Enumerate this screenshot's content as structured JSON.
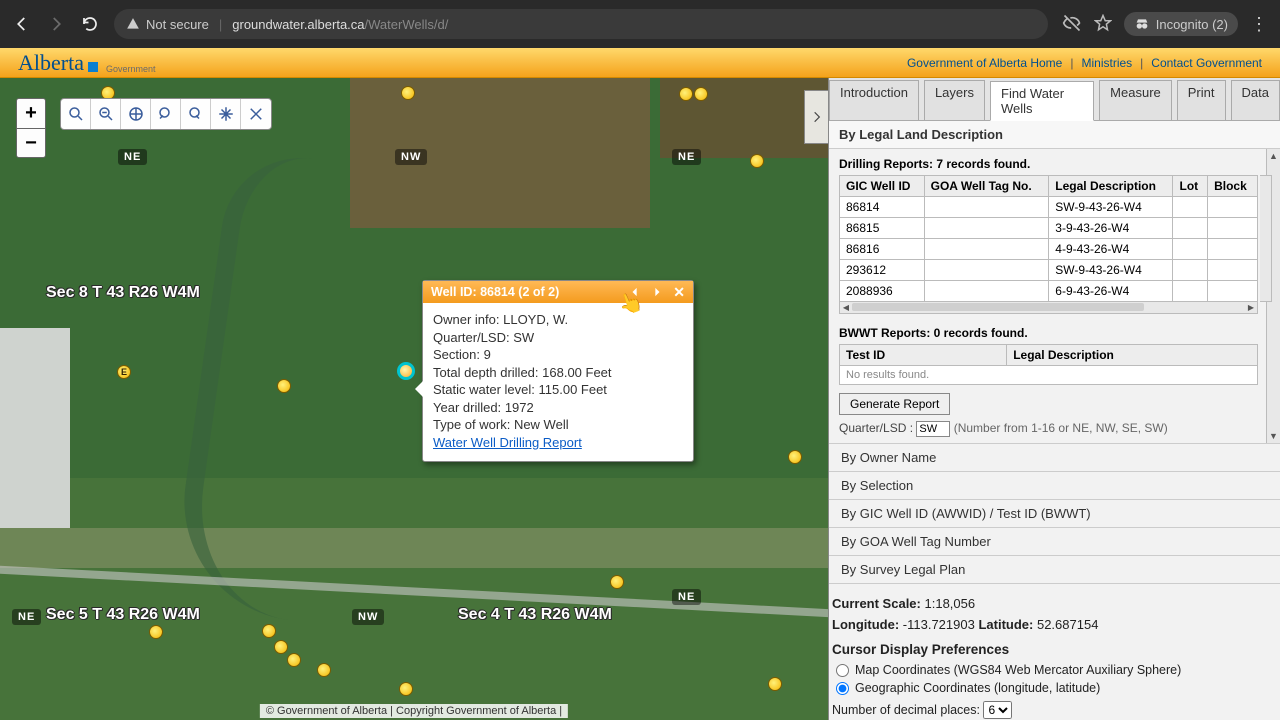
{
  "browser": {
    "not_secure": "Not secure",
    "url_host": "groundwater.alberta.ca",
    "url_path": "/WaterWells/d/",
    "incognito": "Incognito (2)"
  },
  "gov_links": {
    "home": "Government of Alberta Home",
    "ministries": "Ministries",
    "contact": "Contact Government"
  },
  "logo": {
    "word": "Alberta",
    "sub": "Government"
  },
  "tabs": {
    "intro": "Introduction",
    "layers": "Layers",
    "find": "Find Water Wells",
    "measure": "Measure",
    "print": "Print",
    "data": "Data"
  },
  "panel": {
    "section_title": "By Legal Land Description",
    "drill_msg": "Drilling Reports: 7 records found.",
    "cols": {
      "gic": "GIC Well ID",
      "goa": "GOA Well Tag No.",
      "legal": "Legal Description",
      "lot": "Lot",
      "block": "Block"
    },
    "rows": [
      {
        "gic": "86814",
        "goa": "",
        "legal": "SW-9-43-26-W4",
        "lot": "",
        "block": ""
      },
      {
        "gic": "86815",
        "goa": "",
        "legal": "3-9-43-26-W4",
        "lot": "",
        "block": ""
      },
      {
        "gic": "86816",
        "goa": "",
        "legal": "4-9-43-26-W4",
        "lot": "",
        "block": ""
      },
      {
        "gic": "293612",
        "goa": "",
        "legal": "SW-9-43-26-W4",
        "lot": "",
        "block": ""
      },
      {
        "gic": "2088936",
        "goa": "",
        "legal": "6-9-43-26-W4",
        "lot": "",
        "block": ""
      }
    ],
    "bwwt_msg": "BWWT Reports: 0 records found.",
    "bwwt_cols": {
      "test": "Test ID",
      "legal": "Legal Description"
    },
    "bwwt_empty": "No results found.",
    "gen_report": "Generate Report",
    "qlsd_label": "Quarter/LSD :",
    "qlsd_val": "SW",
    "qlsd_hint": "(Number from 1-16 or NE, NW, SE, SW)",
    "choices": {
      "owner": "By Owner Name",
      "selection": "By Selection",
      "gic": "By GIC Well ID (AWWID) / Test ID (BWWT)",
      "goa": "By GOA Well Tag Number",
      "survey": "By Survey Legal Plan"
    },
    "scale_label": "Current Scale:",
    "scale_val": "1:18,056",
    "lon_label": "Longitude:",
    "lon_val": "-113.721903",
    "lat_label": "Latitude:",
    "lat_val": "52.687154",
    "pref_header": "Cursor Display Preferences",
    "pref_map": "Map Coordinates (WGS84 Web Mercator Auxiliary Sphere)",
    "pref_geo": "Geographic Coordinates (longitude, latitude)",
    "dec_label": "Number of decimal places:",
    "dec_val": "6"
  },
  "popup": {
    "title": "Well ID: 86814 (2 of 2)",
    "owner_lbl": "Owner info:",
    "owner_val": "LLOYD, W.",
    "q_lbl": "Quarter/LSD:",
    "q_val": "SW",
    "sec_lbl": "Section:",
    "sec_val": "9",
    "depth_lbl": "Total depth drilled:",
    "depth_val": "168.00 Feet",
    "swl_lbl": "Static water level:",
    "swl_val": "115.00 Feet",
    "year_lbl": "Year drilled:",
    "year_val": "1972",
    "type_lbl": "Type of work:",
    "type_val": "New Well",
    "link": "Water Well Drilling Report"
  },
  "map_labels": {
    "sec8": "Sec 8 T 43 R26 W4M",
    "sec5": "Sec 5 T 43 R26 W4M",
    "sec4": "Sec 4 T 43 R26 W4M",
    "NE": "NE",
    "NW": "NW"
  },
  "attribution": "© Government of Alberta | Copyright Government of Alberta |"
}
